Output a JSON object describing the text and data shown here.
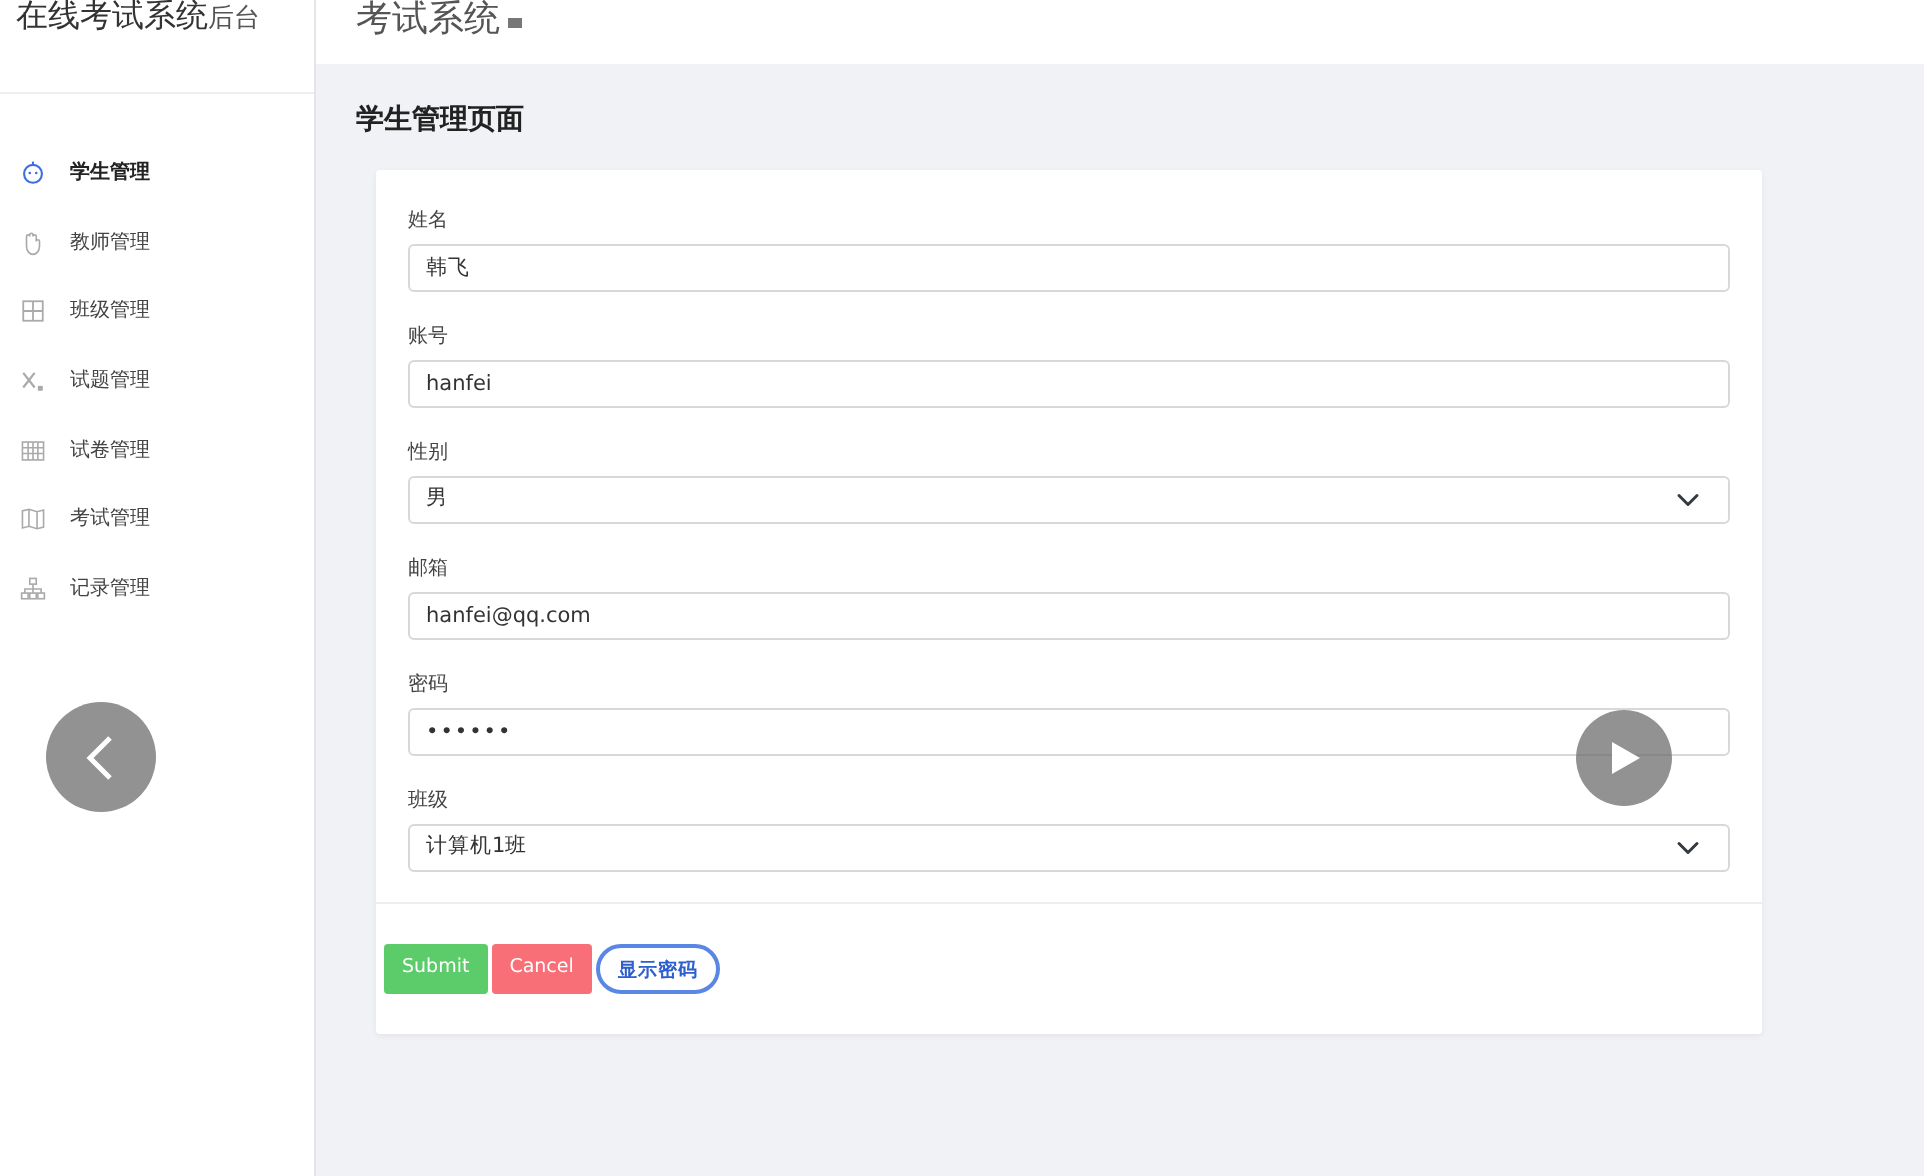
{
  "brand": {
    "title": "在线考试系统",
    "suffix": "后台"
  },
  "header": {
    "title": "考试系统"
  },
  "sidebar": {
    "items": [
      {
        "label": "学生管理",
        "selected": true
      },
      {
        "label": "教师管理",
        "selected": false
      },
      {
        "label": "班级管理",
        "selected": false
      },
      {
        "label": "试题管理",
        "selected": false
      },
      {
        "label": "试卷管理",
        "selected": false
      },
      {
        "label": "考试管理",
        "selected": false
      },
      {
        "label": "记录管理",
        "selected": false
      }
    ]
  },
  "page": {
    "title": "学生管理页面"
  },
  "form": {
    "fields": [
      {
        "label": "姓名",
        "kind": "text",
        "value": "韩飞"
      },
      {
        "label": "账号",
        "kind": "text",
        "value": "hanfei"
      },
      {
        "label": "性别",
        "kind": "select",
        "value": "男"
      },
      {
        "label": "邮箱",
        "kind": "text",
        "value": "hanfei@qq.com"
      },
      {
        "label": "密码",
        "kind": "password",
        "value": "••••••"
      },
      {
        "label": "班级",
        "kind": "select",
        "value": "计算机1班"
      }
    ],
    "buttons": [
      {
        "label": "Submit",
        "kind": "success"
      },
      {
        "label": "Cancel",
        "kind": "danger"
      },
      {
        "label": "显示密码",
        "kind": "outline"
      }
    ]
  }
}
